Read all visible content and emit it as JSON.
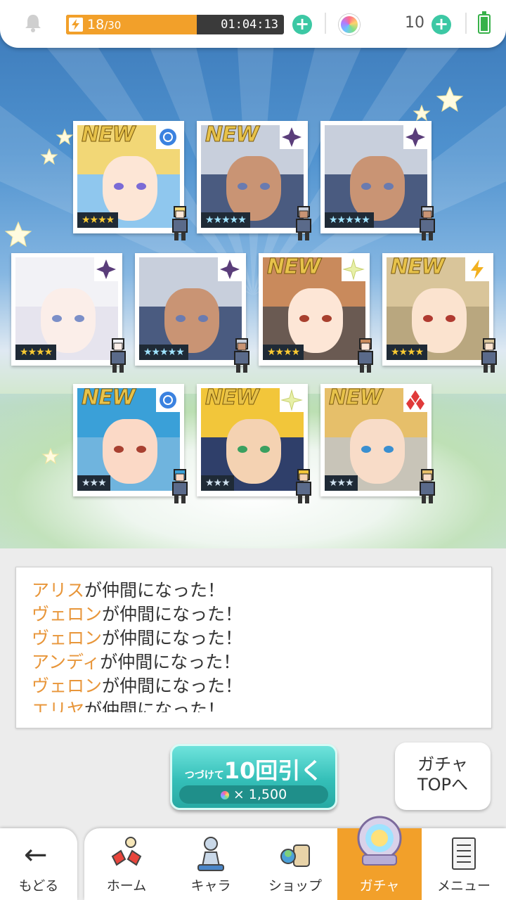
{
  "header": {
    "stamina_current": "18",
    "stamina_max": "/30",
    "stamina_fraction": 0.6,
    "timer": "01:04:13",
    "gem_count": "10",
    "accent_color": "#f2a02a",
    "plus_color": "#3cc8a4"
  },
  "cards": [
    {
      "new": "NEW",
      "stars": "★★★★",
      "rarity": "gold",
      "attribute": "water-circle-icon",
      "hair": "#f2d776",
      "skin": "#fde6d6",
      "eye": "#7b6bd6",
      "bg": "#8fc7ee"
    },
    {
      "new": "NEW",
      "stars": "★★★★★",
      "rarity": "rainbow",
      "attribute": "dark-star-icon",
      "hair": "#c8cfdc",
      "skin": "#c99474",
      "eye": "#6a7bb0",
      "bg": "#4a5b80"
    },
    {
      "new": "",
      "stars": "★★★★★",
      "rarity": "rainbow",
      "attribute": "dark-star-icon",
      "hair": "#c8cfdc",
      "skin": "#c99474",
      "eye": "#6a7bb0",
      "bg": "#4a5b80"
    },
    {
      "new": "",
      "stars": "★★★★",
      "rarity": "gold",
      "attribute": "dark-star-icon",
      "hair": "#f2f2f6",
      "skin": "#fbeee9",
      "eye": "#7b8fc8",
      "bg": "#e6e4ee"
    },
    {
      "new": "",
      "stars": "★★★★★",
      "rarity": "rainbow",
      "attribute": "dark-star-icon",
      "hair": "#c8cfdc",
      "skin": "#c99474",
      "eye": "#6a7bb0",
      "bg": "#4a5b80"
    },
    {
      "new": "NEW",
      "stars": "★★★★",
      "rarity": "gold",
      "attribute": "light-star-icon",
      "hair": "#c98a5c",
      "skin": "#fde6d6",
      "eye": "#a8402e",
      "bg": "#6a5a52"
    },
    {
      "new": "NEW",
      "stars": "★★★★",
      "rarity": "gold",
      "attribute": "lightning-icon",
      "hair": "#d9c59a",
      "skin": "#fbe3cf",
      "eye": "#b03a30",
      "bg": "#b9a77f"
    },
    {
      "new": "NEW",
      "stars": "★★★",
      "rarity": "silver",
      "attribute": "water-circle-icon",
      "hair": "#3aa0d8",
      "skin": "#fbd9c6",
      "eye": "#a84030",
      "bg": "#6fb4de"
    },
    {
      "new": "NEW",
      "stars": "★★★",
      "rarity": "silver",
      "attribute": "light-star-icon",
      "hair": "#f2c63a",
      "skin": "#f4d2b2",
      "eye": "#3aa060",
      "bg": "#2f3f6a"
    },
    {
      "new": "NEW",
      "stars": "★★★",
      "rarity": "silver",
      "attribute": "fire-diamond-icon",
      "hair": "#e6bf6a",
      "skin": "#f8dcc8",
      "eye": "#3a8fd0",
      "bg": "#c8c4b8"
    }
  ],
  "log": [
    {
      "name": "アリス",
      "text": "が仲間になった！"
    },
    {
      "name": "ヴェロン",
      "text": "が仲間になった！"
    },
    {
      "name": "ヴェロン",
      "text": "が仲間になった！"
    },
    {
      "name": "アンディ",
      "text": "が仲間になった！"
    },
    {
      "name": "ヴェロン",
      "text": "が仲間になった！"
    },
    {
      "name": "エリヤ",
      "text": "が仲間になった！"
    }
  ],
  "pull_button": {
    "prefix": "つづけて",
    "main": "10回引く",
    "cost": "× 1,500"
  },
  "gacha_top_button": {
    "line1": "ガチャ",
    "line2": "TOPへ"
  },
  "nav": {
    "back": "もどる",
    "items": [
      {
        "label": "ホーム",
        "icon": "home-icon"
      },
      {
        "label": "キャラ",
        "icon": "character-icon"
      },
      {
        "label": "ショップ",
        "icon": "shop-icon"
      },
      {
        "label": "ガチャ",
        "icon": "gacha-icon",
        "active": true
      },
      {
        "label": "メニュー",
        "icon": "menu-icon"
      }
    ]
  }
}
